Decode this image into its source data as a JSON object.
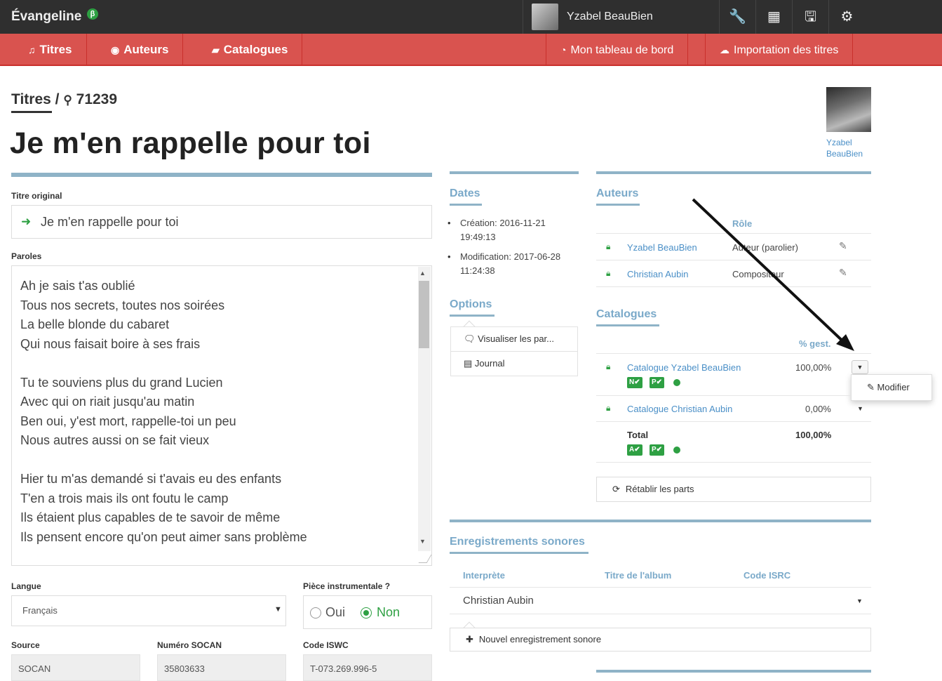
{
  "app": {
    "brand": "Évangeline",
    "beta": "β"
  },
  "topbar": {
    "user_name": "Yzabel BeauBien",
    "icons": [
      "wrench-icon",
      "table-icon",
      "save-icon",
      "gear-icon"
    ],
    "icon_glyphs": [
      "🔧",
      "▦",
      "🖫",
      "⚙"
    ]
  },
  "nav": {
    "titres": "Titres",
    "auteurs": "Auteurs",
    "catalogues": "Catalogues",
    "tableau": "Mon tableau de bord",
    "importation": "Importation des titres"
  },
  "header": {
    "breadcrumb_root": "Titres",
    "breadcrumb_sep": "/",
    "record_id": "71239",
    "title": "Je m'en rappelle pour toi",
    "owner_name": "Yzabel BeauBien"
  },
  "form": {
    "titre_original_label": "Titre original",
    "titre_original_value": "Je m'en rappelle pour toi",
    "paroles_label": "Paroles",
    "paroles": "Ah je sais t'as oublié\nTous nos secrets, toutes nos soirées\nLa belle blonde du cabaret\nQui nous faisait boire à ses frais\n\nTu te souviens plus du grand Lucien\nAvec qui on riait jusqu'au matin\nBen oui, y'est mort, rappelle-toi un peu\nNous autres aussi on se fait vieux\n\nHier tu m'as demandé si t'avais eu des enfants\nT'en a trois mais ils ont foutu le camp\nIls étaient plus capables de te savoir de même\nIls pensent encore qu'on peut aimer sans problème",
    "langue_label": "Langue",
    "langue_value": "Français",
    "piece_label": "Pièce instrumentale ?",
    "oui": "Oui",
    "non": "Non",
    "source_label": "Source",
    "source_value": "SOCAN",
    "socan_label": "Numéro SOCAN",
    "socan_value": "35803633",
    "iswc_label": "Code ISWC",
    "iswc_value": "T-073.269.996-5"
  },
  "dates": {
    "title": "Dates",
    "creation_line1": "Création: 2016-11-21",
    "creation_line2": "19:49:13",
    "modification_line1": "Modification: 2017-06-28",
    "modification_line2": "11:24:38"
  },
  "options": {
    "title": "Options",
    "visualiser": "Visualiser les par...",
    "journal": "Journal"
  },
  "auteurs": {
    "title": "Auteurs",
    "role_header": "Rôle",
    "rows": [
      {
        "name": "Yzabel BeauBien",
        "role": "Auteur (parolier)"
      },
      {
        "name": "Christian Aubin",
        "role": "Compositeur"
      }
    ]
  },
  "catalogues": {
    "title": "Catalogues",
    "pct_header": "% gest.",
    "rows": [
      {
        "name": "Catalogue Yzabel BeauBien",
        "pct": "100,00%",
        "badges": [
          "N✔",
          "P✔"
        ]
      },
      {
        "name": "Catalogue Christian Aubin",
        "pct": "0,00%"
      }
    ],
    "total_label": "Total",
    "total_pct": "100,00%",
    "total_badges": [
      "A✔",
      "P✔"
    ],
    "menu_modifier": "Modifier",
    "retablir": "Rétablir les parts"
  },
  "enregistrements": {
    "title": "Enregistrements sonores",
    "headers": [
      "Interprète",
      "Titre de l'album",
      "Code ISRC"
    ],
    "row_interprete": "Christian Aubin",
    "nouvel": "Nouvel enregistrement sonore"
  }
}
